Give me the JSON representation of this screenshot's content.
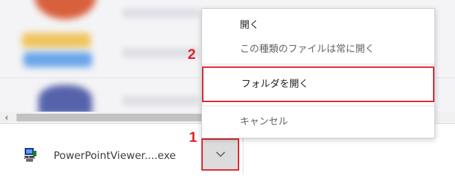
{
  "download_bar": {
    "filename": "PowerPointViewer....exe"
  },
  "context_menu": {
    "items": [
      {
        "label": "開く"
      },
      {
        "label": "この種類のファイルは常に開く"
      },
      {
        "label": "フォルダを開く"
      },
      {
        "label": "キャンセル"
      }
    ]
  },
  "annotations": {
    "step_1": "1",
    "step_2": "2"
  },
  "colors": {
    "highlight": "#e0202a"
  },
  "icons": {
    "file": "application-exe-icon",
    "chevron": "chevron-down-icon"
  }
}
